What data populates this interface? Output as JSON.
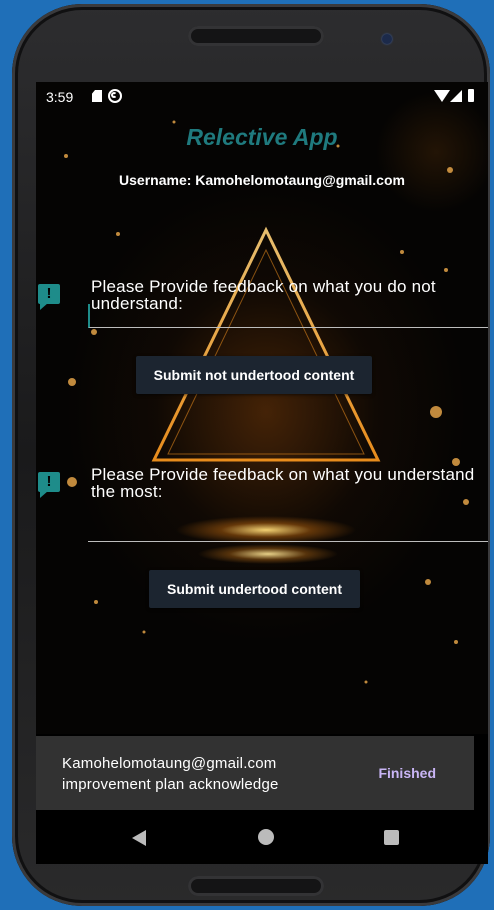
{
  "status": {
    "time": "3:59",
    "icons": [
      "sd-card-icon",
      "sync-icon",
      "wifi-icon",
      "signal-icon",
      "battery-icon"
    ]
  },
  "app": {
    "title": "Relective App",
    "title_color": "#1f7a7e",
    "username": "Username: Kamohelomotaung@gmail.com"
  },
  "feedback_not_understood": {
    "icon": "feedback-icon",
    "prompt": "Please Provide feedback on what you do not understand:",
    "value": "",
    "button": "Submit not undertood content"
  },
  "feedback_understood": {
    "icon": "feedback-icon",
    "prompt": "Please Provide feedback on what you understand the most:",
    "value": "",
    "button": "Submit undertood content"
  },
  "snackbar": {
    "message": "Kamohelomotaung@gmail.com improvement plan acknowledge",
    "action": "Finished",
    "action_color": "#c9b5f5"
  },
  "navbar": {
    "icons": [
      "back-icon",
      "home-icon",
      "recent-apps-icon"
    ]
  }
}
